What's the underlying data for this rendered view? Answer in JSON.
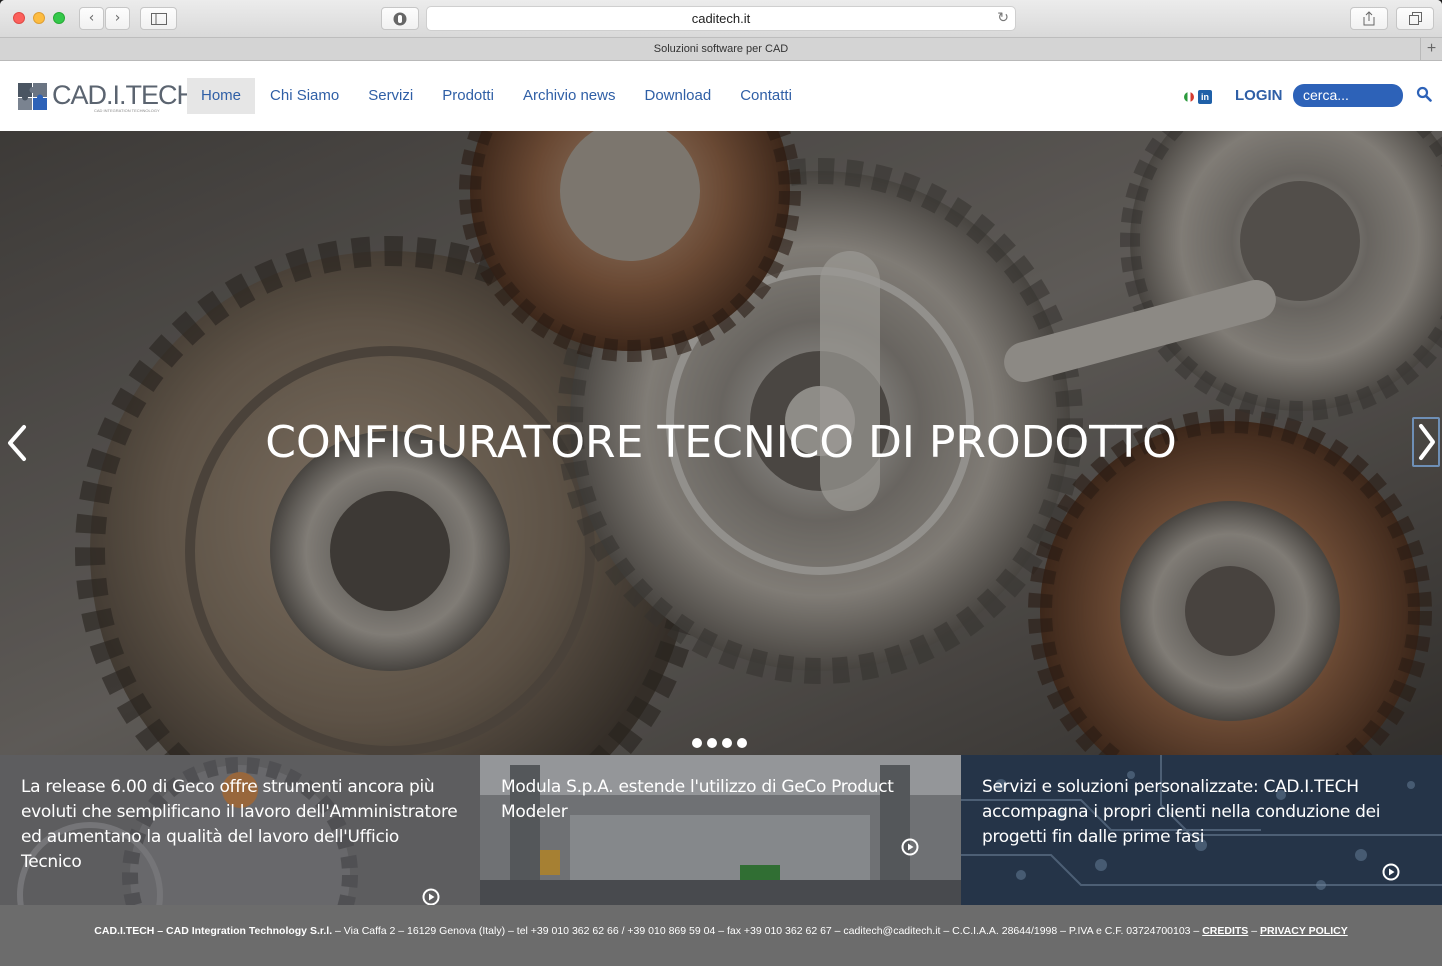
{
  "browser": {
    "url": "caditech.it",
    "tab_title": "Soluzioni software per CAD",
    "back": "‹",
    "forward": "›",
    "new_tab": "+"
  },
  "header": {
    "logo_text": "CAD.I.TECH",
    "logo_sub": "CAD INTEGRATION TECHNOLOGY",
    "nav": [
      "Home",
      "Chi Siamo",
      "Servizi",
      "Prodotti",
      "Archivio news",
      "Download",
      "Contatti"
    ],
    "active_nav": "Home",
    "linkedin": "in",
    "login": "LOGIN",
    "search_placeholder": "cerca..."
  },
  "hero": {
    "title": "CONFIGURATORE TECNICO DI PRODOTTO",
    "slide_count": 4
  },
  "panels": [
    {
      "text": "La release 6.00 di Geco offre strumenti ancora più evoluti che semplificano il lavoro dell'Amministratore ed aumentano la qualità del lavoro dell'Ufficio Tecnico"
    },
    {
      "text": "Modula S.p.A. estende l'utilizzo di GeCo Product Modeler"
    },
    {
      "text": "Servizi e soluzioni personalizzate: CAD.I.TECH accompagna i propri clienti nella conduzione dei progetti fin dalle prime fasi"
    }
  ],
  "footer": {
    "company": "CAD.I.TECH – CAD Integration Technology S.r.l.",
    "details": " – Via Caffa 2 – 16129 Genova (Italy) – tel +39 010 362 62 66 / +39 010 869 59 04 – fax +39 010 362 62 67 – caditech@caditech.it – C.C.I.A.A. 28644/1998 – P.IVA e C.F. 03724700103 – ",
    "credits": "CREDITS",
    "sep": " – ",
    "privacy": "PRIVACY POLICY"
  },
  "colors": {
    "brand_blue": "#2f5fa6",
    "search_bg": "#2d62b8",
    "footer_bg": "#6c6c6c"
  }
}
